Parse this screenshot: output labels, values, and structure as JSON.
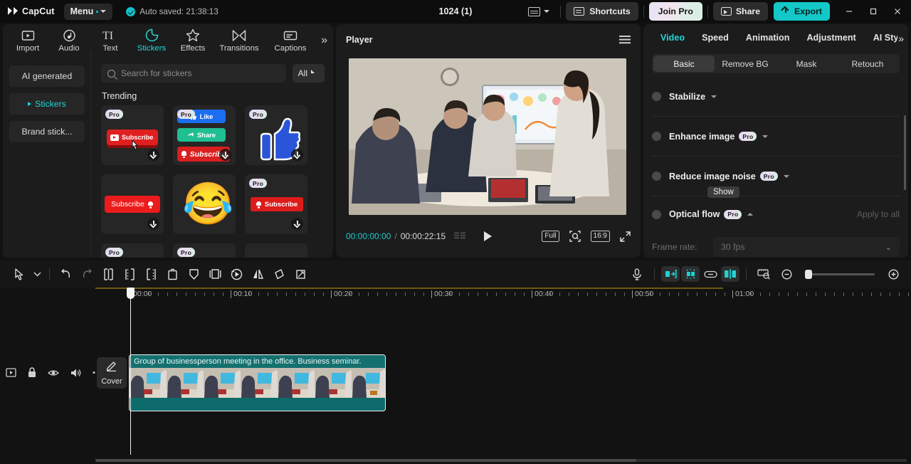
{
  "titlebar": {
    "app_name": "CapCut",
    "menu_label": "Menu",
    "autosave_text": "Auto saved: 21:38:13",
    "project_title": "1024 (1)",
    "keyboard_icon": "keyboard-icon",
    "shortcuts_label": "Shortcuts",
    "join_pro_label": "Join Pro",
    "share_label": "Share",
    "export_label": "Export",
    "minimize": "–",
    "maximize": "☐",
    "close": "✕",
    "accent_color": "#14c8c8"
  },
  "toolbar": {
    "tabs": [
      {
        "label": "Import",
        "icon": "import-icon",
        "active": false
      },
      {
        "label": "Audio",
        "icon": "audio-icon",
        "active": false
      },
      {
        "label": "Text",
        "icon": "text-icon",
        "active": false
      },
      {
        "label": "Stickers",
        "icon": "stickers-icon",
        "active": true
      },
      {
        "label": "Effects",
        "icon": "effects-icon",
        "active": false
      },
      {
        "label": "Transitions",
        "icon": "transitions-icon",
        "active": false
      },
      {
        "label": "Captions",
        "icon": "captions-icon",
        "active": false
      }
    ],
    "more_label": "»"
  },
  "stickers_panel": {
    "categories": [
      {
        "label": "AI generated",
        "active": false
      },
      {
        "label": "Stickers",
        "active": true
      },
      {
        "label": "Brand stick...",
        "active": false
      }
    ],
    "search_placeholder": "Search for stickers",
    "search_value": "",
    "filter_label": "All",
    "section_title": "Trending",
    "pro_badge": "Pro",
    "items": [
      {
        "name": "youtube-subscribe-button",
        "pro": true,
        "label": "Subscribe",
        "download": true
      },
      {
        "name": "like-share-subscribe-stack",
        "pro": true,
        "labels": [
          "Like",
          "Share",
          "Subscribe"
        ],
        "download": true
      },
      {
        "name": "facebook-thumbs-up",
        "pro": true,
        "label": "",
        "download": true
      },
      {
        "name": "red-subscribe-bell",
        "pro": false,
        "label": "Subscribe",
        "download": true
      },
      {
        "name": "laughing-emoji",
        "pro": false,
        "label": "",
        "download": false
      },
      {
        "name": "subscribe-bell-button",
        "pro": true,
        "label": "Subscribe",
        "download": true
      }
    ]
  },
  "player": {
    "title": "Player",
    "menu_icon": "hamburger-icon",
    "current_time": "00:00:00:00",
    "separator": "/",
    "total_time": "00:00:22:15",
    "play_icon": "play-icon",
    "quality_label": "Full",
    "zoom_icon": "zoom-fit-icon",
    "ratio_label": "16:9",
    "fullscreen_icon": "fullscreen-icon"
  },
  "right_panel": {
    "tabs": [
      {
        "label": "Video",
        "active": true
      },
      {
        "label": "Speed",
        "active": false
      },
      {
        "label": "Animation",
        "active": false
      },
      {
        "label": "Adjustment",
        "active": false
      },
      {
        "label": "AI Styli",
        "active": false
      }
    ],
    "more_icon": "»",
    "subtabs": [
      {
        "label": "Basic",
        "active": true
      },
      {
        "label": "Remove BG",
        "active": false
      },
      {
        "label": "Mask",
        "active": false
      },
      {
        "label": "Retouch",
        "active": false
      }
    ],
    "rows": [
      {
        "label": "Stabilize",
        "pro": false,
        "chevron": "down"
      },
      {
        "label": "Enhance image",
        "pro": true,
        "chevron": "down"
      },
      {
        "label": "Reduce image noise",
        "pro": true,
        "chevron": "down"
      },
      {
        "label": "Optical flow",
        "pro": true,
        "chevron": "up"
      }
    ],
    "pro_tag": "Pro",
    "tooltip": "Show",
    "apply_to_all": "Apply to all",
    "frame_rate_label": "Frame rate:",
    "frame_rate_value": "30 fps"
  },
  "timeline_toolbar": {
    "tools": [
      {
        "name": "select-tool-icon"
      },
      {
        "name": "tool-dropdown-caret-icon"
      },
      {
        "name": "undo-icon"
      },
      {
        "name": "redo-icon"
      },
      {
        "name": "split-icon"
      },
      {
        "name": "trim-left-icon"
      },
      {
        "name": "trim-right-icon"
      },
      {
        "name": "delete-icon"
      },
      {
        "name": "freeze-icon"
      },
      {
        "name": "crop-frame-icon"
      },
      {
        "name": "reverse-icon"
      },
      {
        "name": "mirror-icon"
      },
      {
        "name": "rotate-icon"
      },
      {
        "name": "crop-icon"
      }
    ],
    "right_tools": [
      {
        "name": "voiceover-mic-icon",
        "on": false
      },
      {
        "name": "split-screen-icon",
        "on": true
      },
      {
        "name": "auto-fit-icon",
        "on": true
      },
      {
        "name": "link-icon",
        "on": false
      },
      {
        "name": "snap-icon",
        "on": true
      },
      {
        "name": "timeline-preview-icon",
        "on": false
      },
      {
        "name": "zoom-out-icon",
        "on": false
      },
      {
        "name": "zoom-in-icon",
        "on": false
      }
    ]
  },
  "timeline": {
    "ruler_labels": [
      "00:00",
      "00:10",
      "00:20",
      "00:30",
      "00:40",
      "00:50",
      "01:00"
    ],
    "track_controls": [
      {
        "name": "track-type-icon"
      },
      {
        "name": "lock-icon"
      },
      {
        "name": "eye-icon"
      },
      {
        "name": "volume-icon"
      },
      {
        "name": "more-icon"
      }
    ],
    "cover_label": "Cover",
    "cover_icon": "pencil-icon",
    "clip": {
      "title": "Group of businessperson meeting in the office. Business seminar.",
      "color": "#0d6b6b"
    }
  }
}
